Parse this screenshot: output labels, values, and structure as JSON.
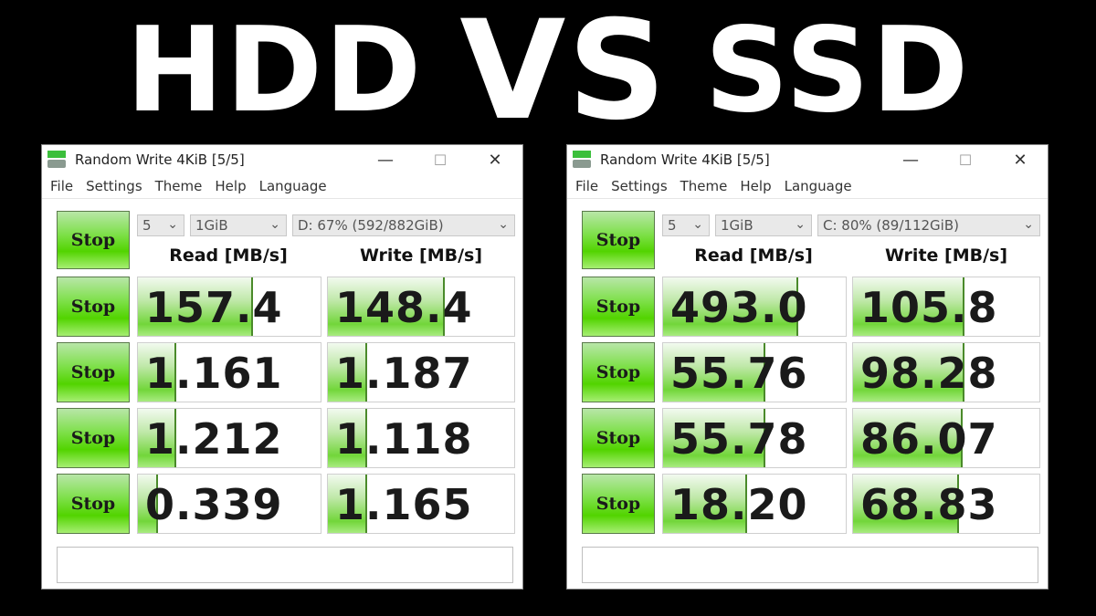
{
  "headline": {
    "left": "HDD",
    "middle": "VS",
    "right": "SSD"
  },
  "windows": [
    {
      "id": "hdd",
      "title": "Random Write 4KiB [5/5]",
      "menu": [
        "File",
        "Settings",
        "Theme",
        "Help",
        "Language"
      ],
      "controls": {
        "all_button": "Stop",
        "count": "5",
        "size": "1GiB",
        "drive": "D: 67% (592/882GiB)"
      },
      "headers": {
        "read": "Read [MB/s]",
        "write": "Write [MB/s]"
      },
      "rows": [
        {
          "button": "Stop",
          "read": "157.4",
          "write": "148.4",
          "read_fill": 0.62,
          "write_fill": 0.62
        },
        {
          "button": "Stop",
          "read": "1.161",
          "write": "1.187",
          "read_fill": 0.2,
          "write_fill": 0.2
        },
        {
          "button": "Stop",
          "read": "1.212",
          "write": "1.118",
          "read_fill": 0.2,
          "write_fill": 0.2
        },
        {
          "button": "Stop",
          "read": "0.339",
          "write": "1.165",
          "read_fill": 0.1,
          "write_fill": 0.2
        }
      ],
      "status": ""
    },
    {
      "id": "ssd",
      "title": "Random Write 4KiB [5/5]",
      "menu": [
        "File",
        "Settings",
        "Theme",
        "Help",
        "Language"
      ],
      "controls": {
        "all_button": "Stop",
        "count": "5",
        "size": "1GiB",
        "drive": "C: 80% (89/112GiB)"
      },
      "headers": {
        "read": "Read [MB/s]",
        "write": "Write [MB/s]"
      },
      "rows": [
        {
          "button": "Stop",
          "read": "493.0",
          "write": "105.8",
          "read_fill": 0.73,
          "write_fill": 0.59
        },
        {
          "button": "Stop",
          "read": "55.76",
          "write": "98.28",
          "read_fill": 0.55,
          "write_fill": 0.59
        },
        {
          "button": "Stop",
          "read": "55.78",
          "write": "86.07",
          "read_fill": 0.55,
          "write_fill": 0.58
        },
        {
          "button": "Stop",
          "read": "18.20",
          "write": "68.83",
          "read_fill": 0.45,
          "write_fill": 0.56
        }
      ],
      "status": ""
    }
  ],
  "window_controls": {
    "minimize": "—",
    "maximize": "☐",
    "close": "✕"
  },
  "colors": {
    "background": "#000000",
    "bar_green": "#52d400",
    "headline": "#ffffff"
  }
}
